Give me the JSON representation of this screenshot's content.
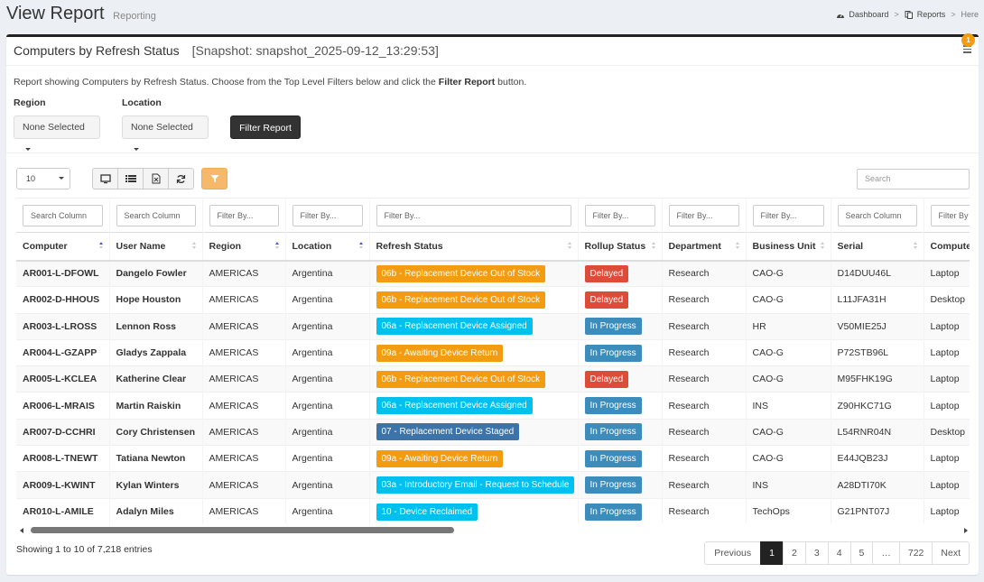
{
  "header": {
    "title": "View Report",
    "subtitle": "Reporting",
    "breadcrumbs": [
      "Dashboard",
      "Reports",
      "Here"
    ]
  },
  "box": {
    "title": "Computers by Refresh Status",
    "snapshot": "[Snapshot: snapshot_2025-09-12_13:29:53]",
    "notification_count": "1"
  },
  "description": {
    "text_before": "Report showing Computers by Refresh Status. Choose from the Top Level Filters below and click the ",
    "bold": "Filter Report",
    "text_after": " button."
  },
  "filters": {
    "region_label": "Region",
    "region_value": "None Selected",
    "location_label": "Location",
    "location_value": "None Selected",
    "filter_button": "Filter Report"
  },
  "toolbar": {
    "page_size": "10",
    "search_placeholder": "Search",
    "icons": [
      "monitor-icon",
      "list-icon",
      "excel-icon",
      "refresh-icon",
      "filter-icon"
    ]
  },
  "table": {
    "column_filters": [
      "Search Column",
      "Search Column",
      "Filter By...",
      "Filter By...",
      "Filter By...",
      "Filter By...",
      "Filter By...",
      "Filter By...",
      "Search Column",
      "Filter By"
    ],
    "columns": [
      "Computer",
      "User Name",
      "Region",
      "Location",
      "Refresh Status",
      "Rollup Status",
      "Department",
      "Business Unit",
      "Serial",
      "Compute"
    ],
    "rows": [
      {
        "computer": "AR001-L-DFOWL",
        "user": "Dangelo Fowler",
        "region": "AMERICAS",
        "location": "Argentina",
        "refresh": "06b - Replacement Device Out of Stock",
        "refresh_color": "orange",
        "rollup": "Delayed",
        "rollup_color": "red",
        "department": "Research",
        "unit": "CAO-G",
        "serial": "D14DUU46L",
        "type": "Laptop"
      },
      {
        "computer": "AR002-D-HHOUS",
        "user": "Hope Houston",
        "region": "AMERICAS",
        "location": "Argentina",
        "refresh": "06b - Replacement Device Out of Stock",
        "refresh_color": "orange",
        "rollup": "Delayed",
        "rollup_color": "red",
        "department": "Research",
        "unit": "CAO-G",
        "serial": "L11JFA31H",
        "type": "Desktop"
      },
      {
        "computer": "AR003-L-LROSS",
        "user": "Lennon Ross",
        "region": "AMERICAS",
        "location": "Argentina",
        "refresh": "06a - Replacement Device Assigned",
        "refresh_color": "cyan",
        "rollup": "In Progress",
        "rollup_color": "blue",
        "department": "Research",
        "unit": "HR",
        "serial": "V50MIE25J",
        "type": "Laptop"
      },
      {
        "computer": "AR004-L-GZAPP",
        "user": "Gladys Zappala",
        "region": "AMERICAS",
        "location": "Argentina",
        "refresh": "09a - Awaiting Device Return",
        "refresh_color": "orange",
        "rollup": "In Progress",
        "rollup_color": "blue",
        "department": "Research",
        "unit": "CAO-G",
        "serial": "P72STB96L",
        "type": "Laptop"
      },
      {
        "computer": "AR005-L-KCLEA",
        "user": "Katherine Clear",
        "region": "AMERICAS",
        "location": "Argentina",
        "refresh": "06b - Replacement Device Out of Stock",
        "refresh_color": "orange",
        "rollup": "Delayed",
        "rollup_color": "red",
        "department": "Research",
        "unit": "CAO-G",
        "serial": "M95FHK19G",
        "type": "Laptop"
      },
      {
        "computer": "AR006-L-MRAIS",
        "user": "Martin Raiskin",
        "region": "AMERICAS",
        "location": "Argentina",
        "refresh": "06a - Replacement Device Assigned",
        "refresh_color": "cyan",
        "rollup": "In Progress",
        "rollup_color": "blue",
        "department": "Research",
        "unit": "INS",
        "serial": "Z90HKC71G",
        "type": "Laptop"
      },
      {
        "computer": "AR007-D-CCHRI",
        "user": "Cory Christensen",
        "region": "AMERICAS",
        "location": "Argentina",
        "refresh": "07 - Replacement Device Staged",
        "refresh_color": "slate",
        "rollup": "In Progress",
        "rollup_color": "blue",
        "department": "Research",
        "unit": "CAO-G",
        "serial": "L54RNR04N",
        "type": "Desktop"
      },
      {
        "computer": "AR008-L-TNEWT",
        "user": "Tatiana Newton",
        "region": "AMERICAS",
        "location": "Argentina",
        "refresh": "09a - Awaiting Device Return",
        "refresh_color": "orange",
        "rollup": "In Progress",
        "rollup_color": "blue",
        "department": "Research",
        "unit": "CAO-G",
        "serial": "E44JQB23J",
        "type": "Laptop"
      },
      {
        "computer": "AR009-L-KWINT",
        "user": "Kylan Winters",
        "region": "AMERICAS",
        "location": "Argentina",
        "refresh": "03a - Introductory Email - Request to Schedule",
        "refresh_color": "cyan",
        "rollup": "In Progress",
        "rollup_color": "blue",
        "department": "Research",
        "unit": "INS",
        "serial": "A28DTI70K",
        "type": "Laptop"
      },
      {
        "computer": "AR010-L-AMILE",
        "user": "Adalyn Miles",
        "region": "AMERICAS",
        "location": "Argentina",
        "refresh": "10 - Device Reclaimed",
        "refresh_color": "cyan",
        "rollup": "In Progress",
        "rollup_color": "blue",
        "department": "Research",
        "unit": "TechOps",
        "serial": "G21PNT07J",
        "type": "Laptop"
      }
    ]
  },
  "footer": {
    "info": "Showing 1 to 10 of 7,218 entries",
    "pages": [
      "Previous",
      "1",
      "2",
      "3",
      "4",
      "5",
      "…",
      "722",
      "Next"
    ],
    "active_page": "1"
  },
  "colors": {
    "orange": "#f39c12",
    "cyan": "#00c0ef",
    "blue": "#3c8dbc",
    "slate": "#3c73a8",
    "red": "#dd4b39"
  }
}
